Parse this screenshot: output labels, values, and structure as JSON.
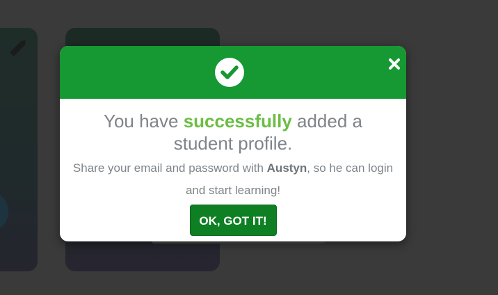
{
  "modal": {
    "headline_prefix": "You have ",
    "headline_highlight": "successfully",
    "headline_suffix": " added a student profile.",
    "sub_prefix": "Share your email and password with ",
    "student_name": "Austyn",
    "sub_suffix": ", so he can login and start learning!",
    "ok_label": "OK, GOT IT!",
    "icons": {
      "header": "check-circle-icon",
      "close": "close-icon"
    }
  },
  "colors": {
    "header_green": "#169833",
    "highlight_green": "#6cbd45",
    "button_green": "#0f7f24",
    "overlay": "#3a3a3a"
  }
}
